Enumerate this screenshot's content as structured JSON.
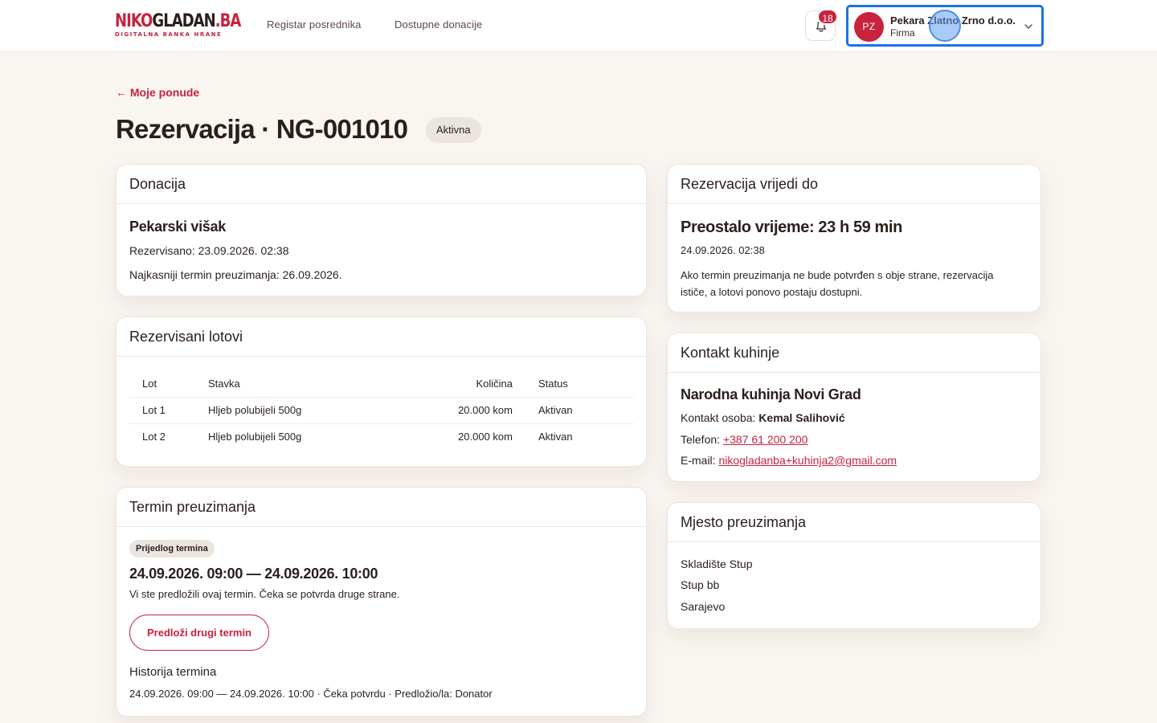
{
  "header": {
    "logo_main_red": "NIKO",
    "logo_main_dark": "GLADAN",
    "logo_main_suffix": ".BA",
    "logo_tagline": "DIGITALNA BANKA HRANE",
    "nav": [
      "Registar posrednika",
      "Dostupne donacije"
    ],
    "notifications_count": "18",
    "user": {
      "initials": "PZ",
      "name": "Pekara Zlatno Zrno d.o.o.",
      "role": "Firma"
    }
  },
  "page": {
    "back_link": "← Moje ponude",
    "title": "Rezervacija · NG-001010",
    "status": "Aktivna"
  },
  "donation": {
    "heading": "Donacija",
    "name": "Pekarski višak",
    "reserved": "Rezervisano: 23.09.2026. 02:38",
    "latest_pickup": "Najkasniji termin preuzimanja: 26.09.2026."
  },
  "lots": {
    "heading": "Rezervisani lotovi",
    "columns": [
      "Lot",
      "Stavka",
      "Količina",
      "Status"
    ],
    "rows": [
      [
        "Lot 1",
        "Hljeb polubijeli 500g",
        "20.000 kom",
        "Aktivan"
      ],
      [
        "Lot 2",
        "Hljeb polubijeli 500g",
        "20.000 kom",
        "Aktivan"
      ]
    ]
  },
  "pickup_term": {
    "heading": "Termin preuzimanja",
    "chip": "Prijedlog termina",
    "range": "24.09.2026. 09:00 — 24.09.2026. 10:00",
    "note": "Vi ste predložili ovaj termin. Čeka se potvrda druge strane.",
    "propose_button": "Predloži drugi termin",
    "history_heading": "Historija termina",
    "history_item": "24.09.2026. 09:00 — 24.09.2026. 10:00 · Čeka potvrdu · Predložio/la: Donator"
  },
  "valid_until": {
    "heading": "Rezervacija vrijedi do",
    "remaining": "Preostalo vrijeme: 23 h 59 min",
    "date": "24.09.2026. 02:38",
    "info": "Ako termin preuzimanja ne bude potvrđen s obje strane, rezervacija ističe, a lotovi ponovo postaju dostupni."
  },
  "kitchen": {
    "heading": "Kontakt kuhinje",
    "name": "Narodna kuhinja Novi Grad",
    "contact_label": "Kontakt osoba: ",
    "contact_person": "Kemal Salihović",
    "phone_label": "Telefon: ",
    "phone": "+387 61 200 200",
    "email_label": "E-mail: ",
    "email": "nikogladanba+kuhinja2@gmail.com"
  },
  "place": {
    "heading": "Mjesto preuzimanja",
    "lines": [
      "Skladište Stup",
      "Stup bb",
      "Sarajevo"
    ]
  },
  "colors": {
    "brand": "#c8223d",
    "background": "#f9f5f1",
    "focus": "#1a73e8"
  }
}
